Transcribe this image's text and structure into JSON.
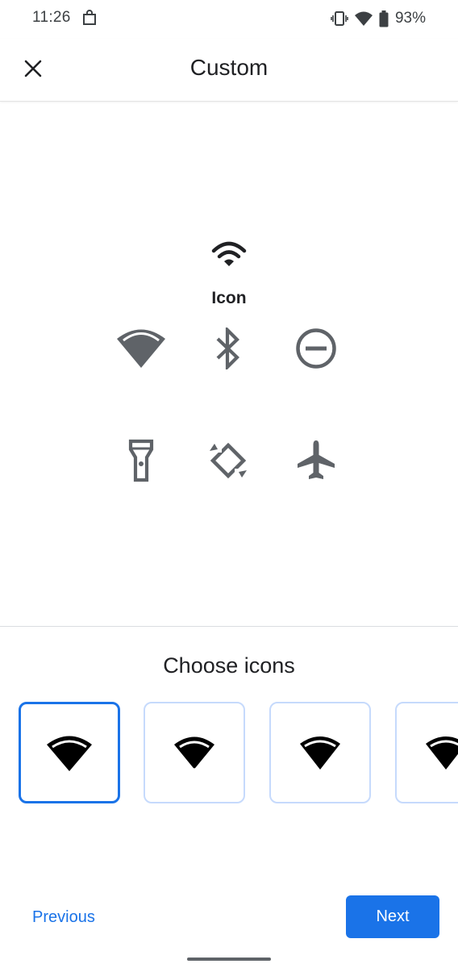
{
  "status_bar": {
    "time": "11:26",
    "battery": "93%",
    "icons": [
      "shopping-bag-icon",
      "vibrate-icon",
      "wifi-signal-icon",
      "battery-icon"
    ]
  },
  "app_bar": {
    "title": "Custom",
    "close_icon": "close-icon"
  },
  "preview": {
    "icon": "wifi-icon",
    "label": "Icon",
    "tiles": [
      {
        "icon": "wifi-icon"
      },
      {
        "icon": "bluetooth-icon"
      },
      {
        "icon": "do-not-disturb-icon"
      },
      {
        "icon": "flashlight-icon"
      },
      {
        "icon": "auto-rotate-icon"
      },
      {
        "icon": "airplane-mode-icon"
      }
    ]
  },
  "chooser": {
    "title": "Choose icons",
    "options": [
      {
        "icon": "wifi-style-1-icon",
        "selected": true
      },
      {
        "icon": "wifi-style-2-icon",
        "selected": false
      },
      {
        "icon": "wifi-style-3-icon",
        "selected": false
      },
      {
        "icon": "wifi-style-4-icon",
        "selected": false
      }
    ]
  },
  "footer": {
    "previous_label": "Previous",
    "next_label": "Next"
  },
  "colors": {
    "accent": "#1a73e8",
    "icon_gray": "#5f6368",
    "text": "#202124",
    "selected_border": "#1a73e8",
    "unselected_border": "#c6dafc"
  }
}
